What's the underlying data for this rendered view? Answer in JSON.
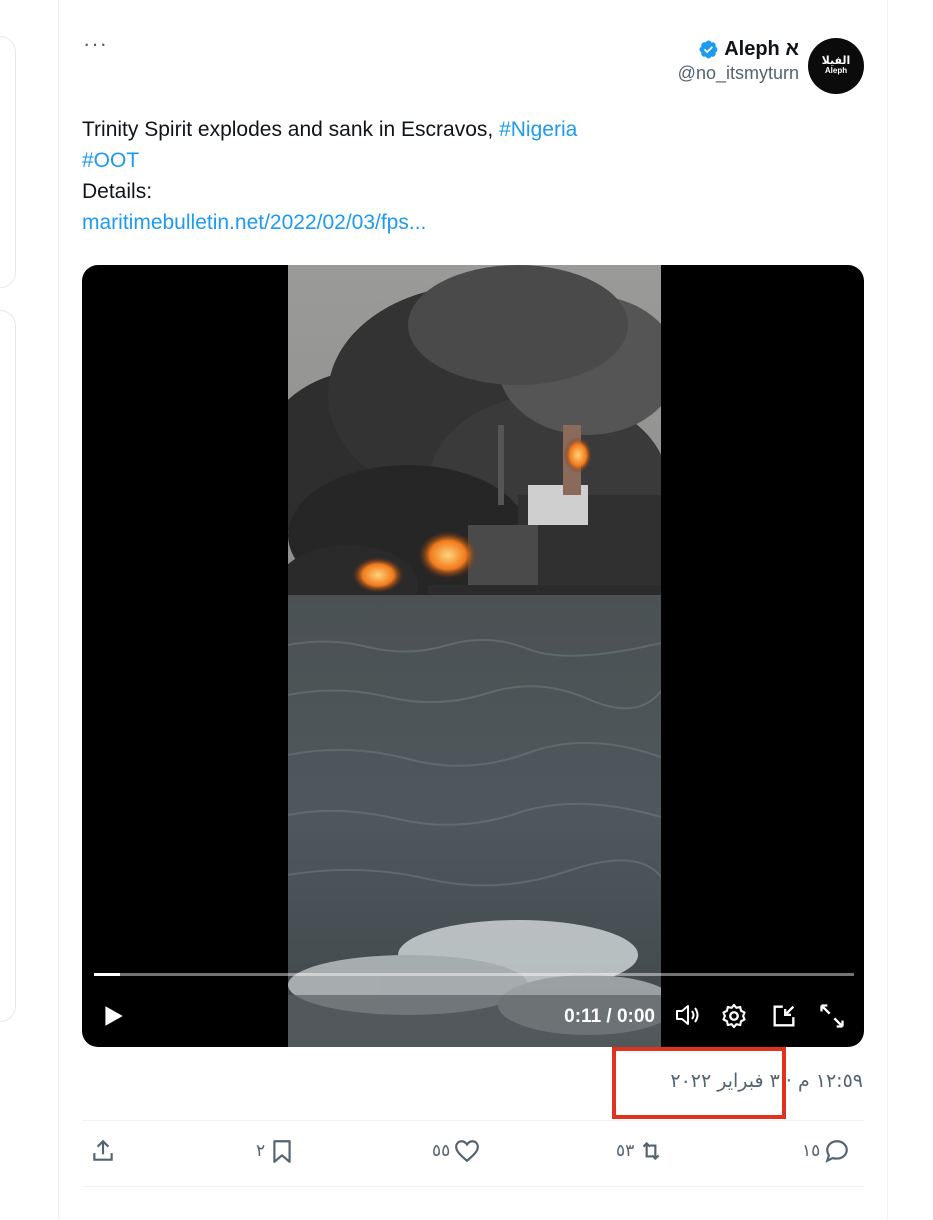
{
  "tweet": {
    "author_name": "Aleph א",
    "author_handle": "@no_itsmyturn",
    "avatar_text_ar": "الفيلا",
    "avatar_text_en": "Aleph",
    "more_label": "···",
    "text_line1": "Trinity Spirit explodes and sank in Escravos, ",
    "hashtag1": "#Nigeria",
    "hashtag2": "#OOT",
    "details_label": "Details:",
    "link": "maritimebulletin.net/2022/02/03/fps..."
  },
  "video": {
    "time_display": "0:11 / 0:00",
    "progress_fraction": 0.034
  },
  "timestamp": "١٢:٥٩ م · ٣ فبراير ٢٠٢٢",
  "actions": {
    "reply_count": "١٥",
    "retweet_count": "٥٣",
    "like_count": "٥٥",
    "bookmark_count": "٢"
  },
  "colors": {
    "link": "#1d9bf0",
    "verified": "#1d9bf0",
    "highlight_box": "#e0321f",
    "muted_text": "#536471"
  },
  "icons": [
    "more-icon",
    "verified-icon",
    "play-icon",
    "volume-icon",
    "settings-icon",
    "pip-icon",
    "fullscreen-icon",
    "share-icon",
    "bookmark-icon",
    "like-icon",
    "retweet-icon",
    "reply-icon"
  ]
}
